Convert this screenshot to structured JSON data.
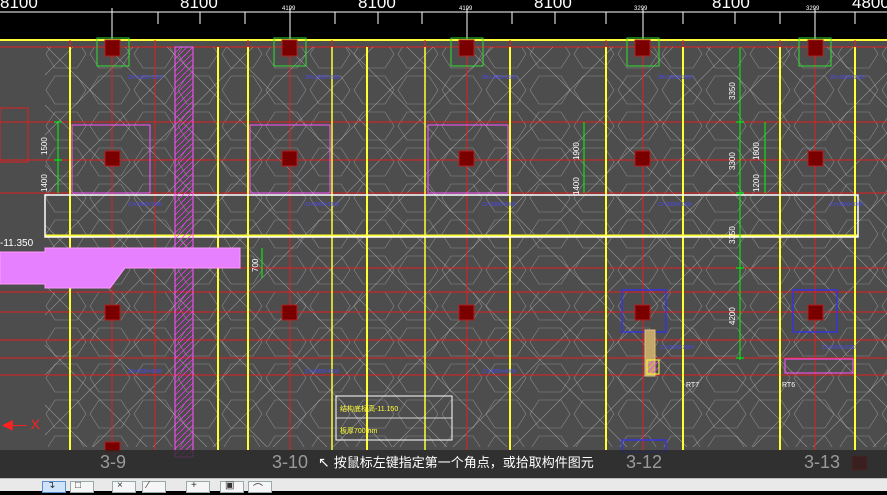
{
  "top_ruler": {
    "spans": [
      "8100",
      "8100",
      "8100",
      "8100",
      "8100",
      "4800"
    ],
    "small_dims": [
      "4199",
      "4199",
      "3299",
      "3299"
    ]
  },
  "axis_ids": [
    "3-9",
    "3-10",
    "3-12",
    "3-13"
  ],
  "elevation_label": "-11.350",
  "dims_vertical": [
    "1500",
    "1400",
    "1900",
    "1400",
    "3350",
    "3300",
    "1800",
    "1200",
    "3350",
    "4200"
  ],
  "dim_700": "700",
  "column_labels": [
    "RT7",
    "RT6"
  ],
  "note_box": {
    "line1": "结构底标高-11.150",
    "line2": "板厚700mm"
  },
  "status_bar": {
    "hint": "按鼠标左键指定第一个角点，或拾取构件图元"
  },
  "axis_marker": "X",
  "colors": {
    "background": "#4d4d4d",
    "grid_red": "#e02020",
    "beam_yellow": "#ffff33",
    "slab_white": "#ffffff",
    "column_darkred": "#7a0000",
    "annotation_blue": "#3030ff",
    "highlight_magenta": "#e680ff",
    "dimension_green": "#00ff00"
  },
  "toolbar": {
    "tools": [
      "select-icon",
      "rect-select-icon",
      "cross-icon",
      "polyline-icon",
      "add-icon",
      "layer-icon",
      "arc-icon"
    ]
  }
}
